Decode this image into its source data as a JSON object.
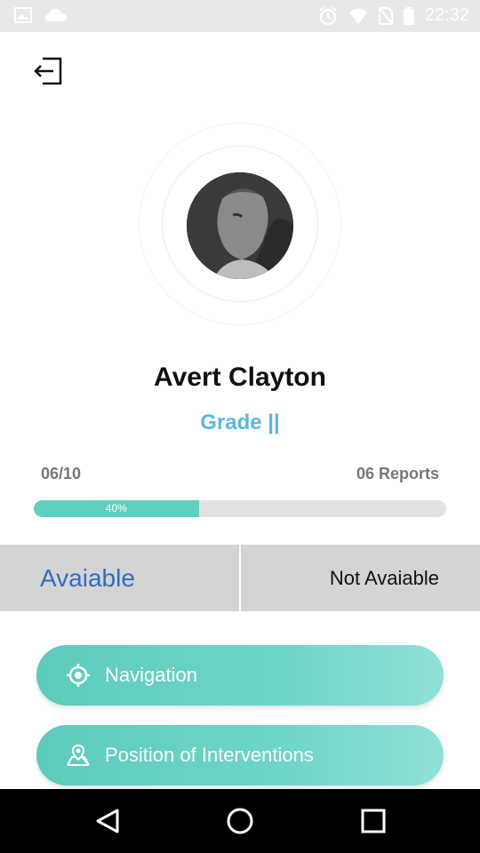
{
  "status_bar": {
    "time": "22:32",
    "left_icons": [
      "image-icon",
      "cloud-icon"
    ],
    "right_icons": [
      "alarm-icon",
      "wifi-icon",
      "no-sim-icon",
      "battery-icon"
    ]
  },
  "header": {
    "back_icon": "logout-arrow-icon"
  },
  "profile": {
    "name": "Avert Clayton",
    "grade": "Grade ||"
  },
  "progress": {
    "count_text": "06/10",
    "reports_text": "06 Reports",
    "percent": 40,
    "percent_label": "40%",
    "color_fill": "#5fcfbf",
    "color_track": "#e2e2e2"
  },
  "availability": {
    "available_label": "Avaiable",
    "not_available_label": "Not Avaiable",
    "selected": "available",
    "color_selected": "#2f6fbf"
  },
  "actions": [
    {
      "label": "Navigation",
      "icon": "crosshair-icon"
    },
    {
      "label": "Position of Interventions",
      "icon": "map-pin-icon"
    }
  ],
  "nav_bar": {
    "keys": [
      "back-triangle-icon",
      "home-circle-icon",
      "recents-square-icon"
    ]
  },
  "colors": {
    "accent": "#5bb6e6",
    "button_gradient_start": "#5ccbbc",
    "button_gradient_end": "#8fe0d6"
  }
}
